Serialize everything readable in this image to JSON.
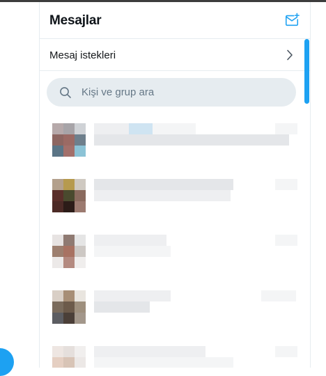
{
  "messages": {
    "title": "Mesajlar",
    "compose_icon": "new-message-icon",
    "requests_label": "Mesaj istekleri",
    "requests_icon": "chevron-right-icon",
    "search_placeholder": "Kişi ve grup ara",
    "search_value": "",
    "search_icon": "search-icon",
    "conversation_count": 5
  },
  "colors": {
    "accent": "#1da1f2",
    "search_bg": "#e6ecf0",
    "divider": "#e6ecf0",
    "placeholder": "#657786"
  }
}
